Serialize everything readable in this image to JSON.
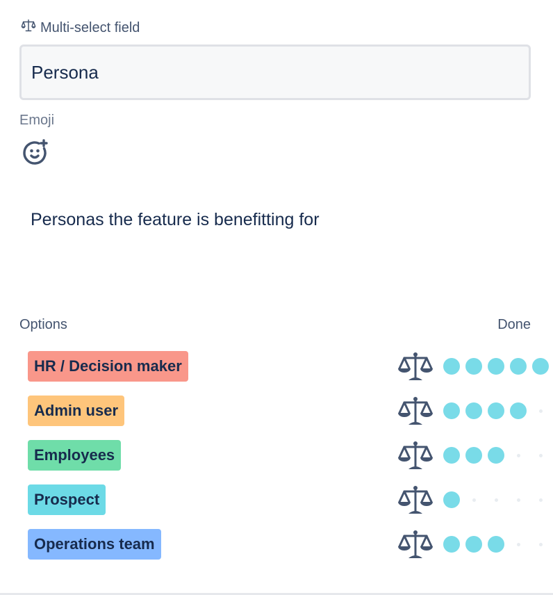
{
  "field_type": {
    "label": "Multi-select field",
    "icon": "scale-icon"
  },
  "name_input": {
    "value": "Persona"
  },
  "emoji": {
    "label": "Emoji",
    "icon": "add-emoji-icon"
  },
  "description": "Personas the feature is benefitting for",
  "options_header": {
    "label": "Options",
    "done_label": "Done"
  },
  "options": [
    {
      "label": "HR / Decision maker",
      "color": "#f9978a",
      "weight": 5,
      "max_weight": 5
    },
    {
      "label": "Admin user",
      "color": "#fec57b",
      "weight": 4,
      "max_weight": 5
    },
    {
      "label": "Employees",
      "color": "#6fdda9",
      "weight": 3,
      "max_weight": 5
    },
    {
      "label": "Prospect",
      "color": "#6cdae6",
      "weight": 1,
      "max_weight": 5
    },
    {
      "label": "Operations team",
      "color": "#85b8ff",
      "weight": 3,
      "max_weight": 5
    }
  ],
  "colors": {
    "weight_dot": "#79dbe8",
    "icon": "#44546f"
  }
}
